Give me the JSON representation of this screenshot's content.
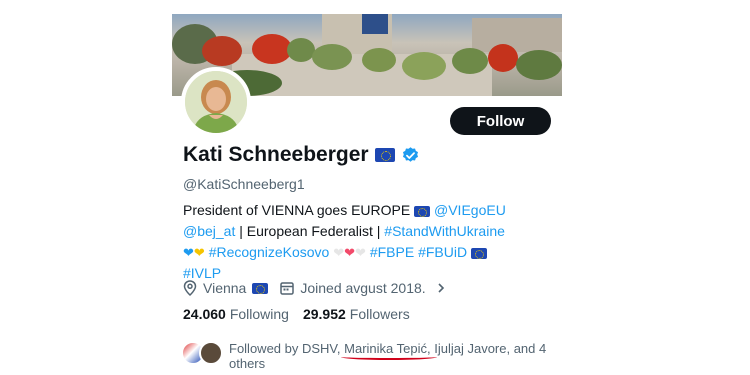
{
  "profile": {
    "display_name": "Kati Schneeberger",
    "handle": "@KatiSchneeberg1",
    "follow_label": "Follow",
    "bio": {
      "t1": "President of VIENNA goes EUROPE",
      "l1": "@VIEgoEU",
      "l2": "@bej_at",
      "t2": " | European Federalist | ",
      "l3": "#StandWithUkraine",
      "l4": "#RecognizeKosovo",
      "l5": "#FBPE",
      "l6": "#FBUiD",
      "l7": "#IVLP"
    },
    "location": "Vienna",
    "joined": "Joined avgust 2018."
  },
  "stats": {
    "following_count": "24.060",
    "following_label": "Following",
    "followers_count": "29.952",
    "followers_label": "Followers"
  },
  "followed_by": {
    "prefix": "Followed by DSHV, ",
    "highlighted": "Marinika Tepić",
    "suffix": ", Ijuljaj Javore, and 4 others"
  },
  "colors": {
    "link": "#1d9bf0",
    "button_bg": "#0f1419",
    "muted": "#536471",
    "annotation": "#d0021b"
  },
  "icons": [
    "eu-flag-icon",
    "verified-badge-icon",
    "location-pin-icon",
    "calendar-icon",
    "chevron-right-icon",
    "blue-heart-icon",
    "yellow-heart-icon",
    "white-heart-icon",
    "red-heart-icon"
  ]
}
